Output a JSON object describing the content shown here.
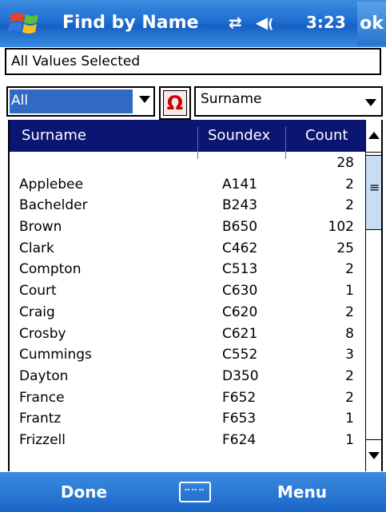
{
  "titlebar": {
    "title": "Find by Name",
    "time": "3:23",
    "ok_label": "ok"
  },
  "selection": {
    "text": "All Values Selected"
  },
  "filters": {
    "left_dropdown": "All",
    "omega_symbol": "Ω",
    "right_dropdown": "Surname"
  },
  "table": {
    "headers": [
      "Surname",
      "Soundex",
      "Count"
    ],
    "rows": [
      {
        "surname": "",
        "soundex": "",
        "count": "28"
      },
      {
        "surname": "Applebee",
        "soundex": "A141",
        "count": "2"
      },
      {
        "surname": "Bachelder",
        "soundex": "B243",
        "count": "2"
      },
      {
        "surname": "Brown",
        "soundex": "B650",
        "count": "102"
      },
      {
        "surname": "Clark",
        "soundex": "C462",
        "count": "25"
      },
      {
        "surname": "Compton",
        "soundex": "C513",
        "count": "2"
      },
      {
        "surname": "Court",
        "soundex": "C630",
        "count": "1"
      },
      {
        "surname": "Craig",
        "soundex": "C620",
        "count": "2"
      },
      {
        "surname": "Crosby",
        "soundex": "C621",
        "count": "8"
      },
      {
        "surname": "Cummings",
        "soundex": "C552",
        "count": "3"
      },
      {
        "surname": "Dayton",
        "soundex": "D350",
        "count": "2"
      },
      {
        "surname": "France",
        "soundex": "F652",
        "count": "2"
      },
      {
        "surname": "Frantz",
        "soundex": "F653",
        "count": "1"
      },
      {
        "surname": "Frizzell",
        "soundex": "F624",
        "count": "1"
      }
    ]
  },
  "bottombar": {
    "left_label": "Done",
    "right_label": "Menu"
  }
}
